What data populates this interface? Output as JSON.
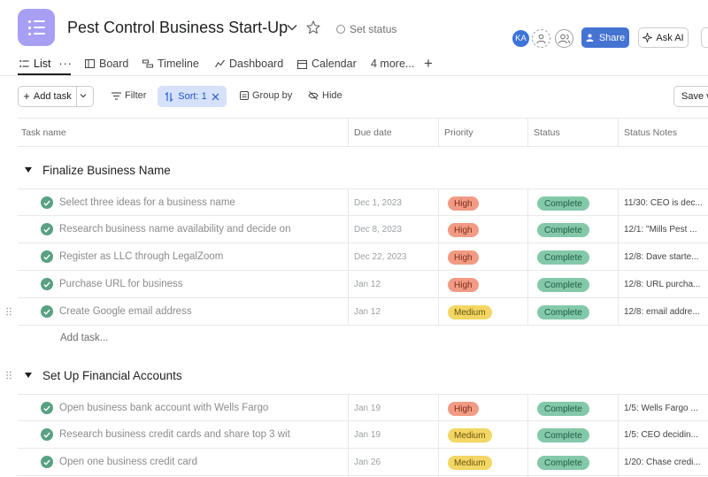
{
  "project": {
    "title": "Pest Control Business Start-Up",
    "set_status": "Set status"
  },
  "header": {
    "avatar_initials": "KA",
    "share_label": "Share",
    "ask_ai_label": "Ask AI"
  },
  "tabs": [
    {
      "label": "List"
    },
    {
      "label": "Board"
    },
    {
      "label": "Timeline"
    },
    {
      "label": "Dashboard"
    },
    {
      "label": "Calendar"
    },
    {
      "label": "4 more..."
    }
  ],
  "toolbar": {
    "add_task_label": "Add task",
    "filter_label": "Filter",
    "sort_label": "Sort: 1",
    "group_by_label": "Group by",
    "hide_label": "Hide",
    "save_view_label": "Save vi"
  },
  "columns": [
    "Task name",
    "Due date",
    "Priority",
    "Status",
    "Status Notes"
  ],
  "sections": [
    {
      "title": "Finalize Business Name",
      "tasks": [
        {
          "name": "Select three ideas for a business name",
          "due": "Dec 1, 2023",
          "priority": "High",
          "status": "Complete",
          "notes": "11/30: CEO is dec..."
        },
        {
          "name": "Research business name availability and decide on",
          "due": "Dec 8, 2023",
          "priority": "High",
          "status": "Complete",
          "notes": "12/1: \"Mills Pest ..."
        },
        {
          "name": "Register as LLC through LegalZoom",
          "due": "Dec 22, 2023",
          "priority": "High",
          "status": "Complete",
          "notes": "12/8: Dave starte..."
        },
        {
          "name": "Purchase URL for business",
          "due": "Jan 12",
          "priority": "High",
          "status": "Complete",
          "notes": "12/8: URL purcha..."
        },
        {
          "name": "Create Google email address",
          "due": "Jan 12",
          "priority": "Medium",
          "status": "Complete",
          "notes": "12/8: email addre..."
        }
      ],
      "add_task_label": "Add task..."
    },
    {
      "title": "Set Up Financial Accounts",
      "tasks": [
        {
          "name": "Open business bank account with Wells Fargo",
          "due": "Jan 19",
          "priority": "High",
          "status": "Complete",
          "notes": "1/5: Wells Fargo ..."
        },
        {
          "name": "Research business credit cards and share top 3 wit",
          "due": "Jan 19",
          "priority": "Medium",
          "status": "Complete",
          "notes": "1/5: CEO decidin..."
        },
        {
          "name": "Open one business credit card",
          "due": "Jan 26",
          "priority": "Medium",
          "status": "Complete",
          "notes": "1/20: Chase credi..."
        }
      ]
    }
  ],
  "colors": {
    "accent": "#4573d2",
    "app_icon": "#a69ff3",
    "priority_high": "#f29b84",
    "priority_medium": "#f3d664",
    "status_complete": "#83c9a9",
    "check_green": "#58a182"
  }
}
